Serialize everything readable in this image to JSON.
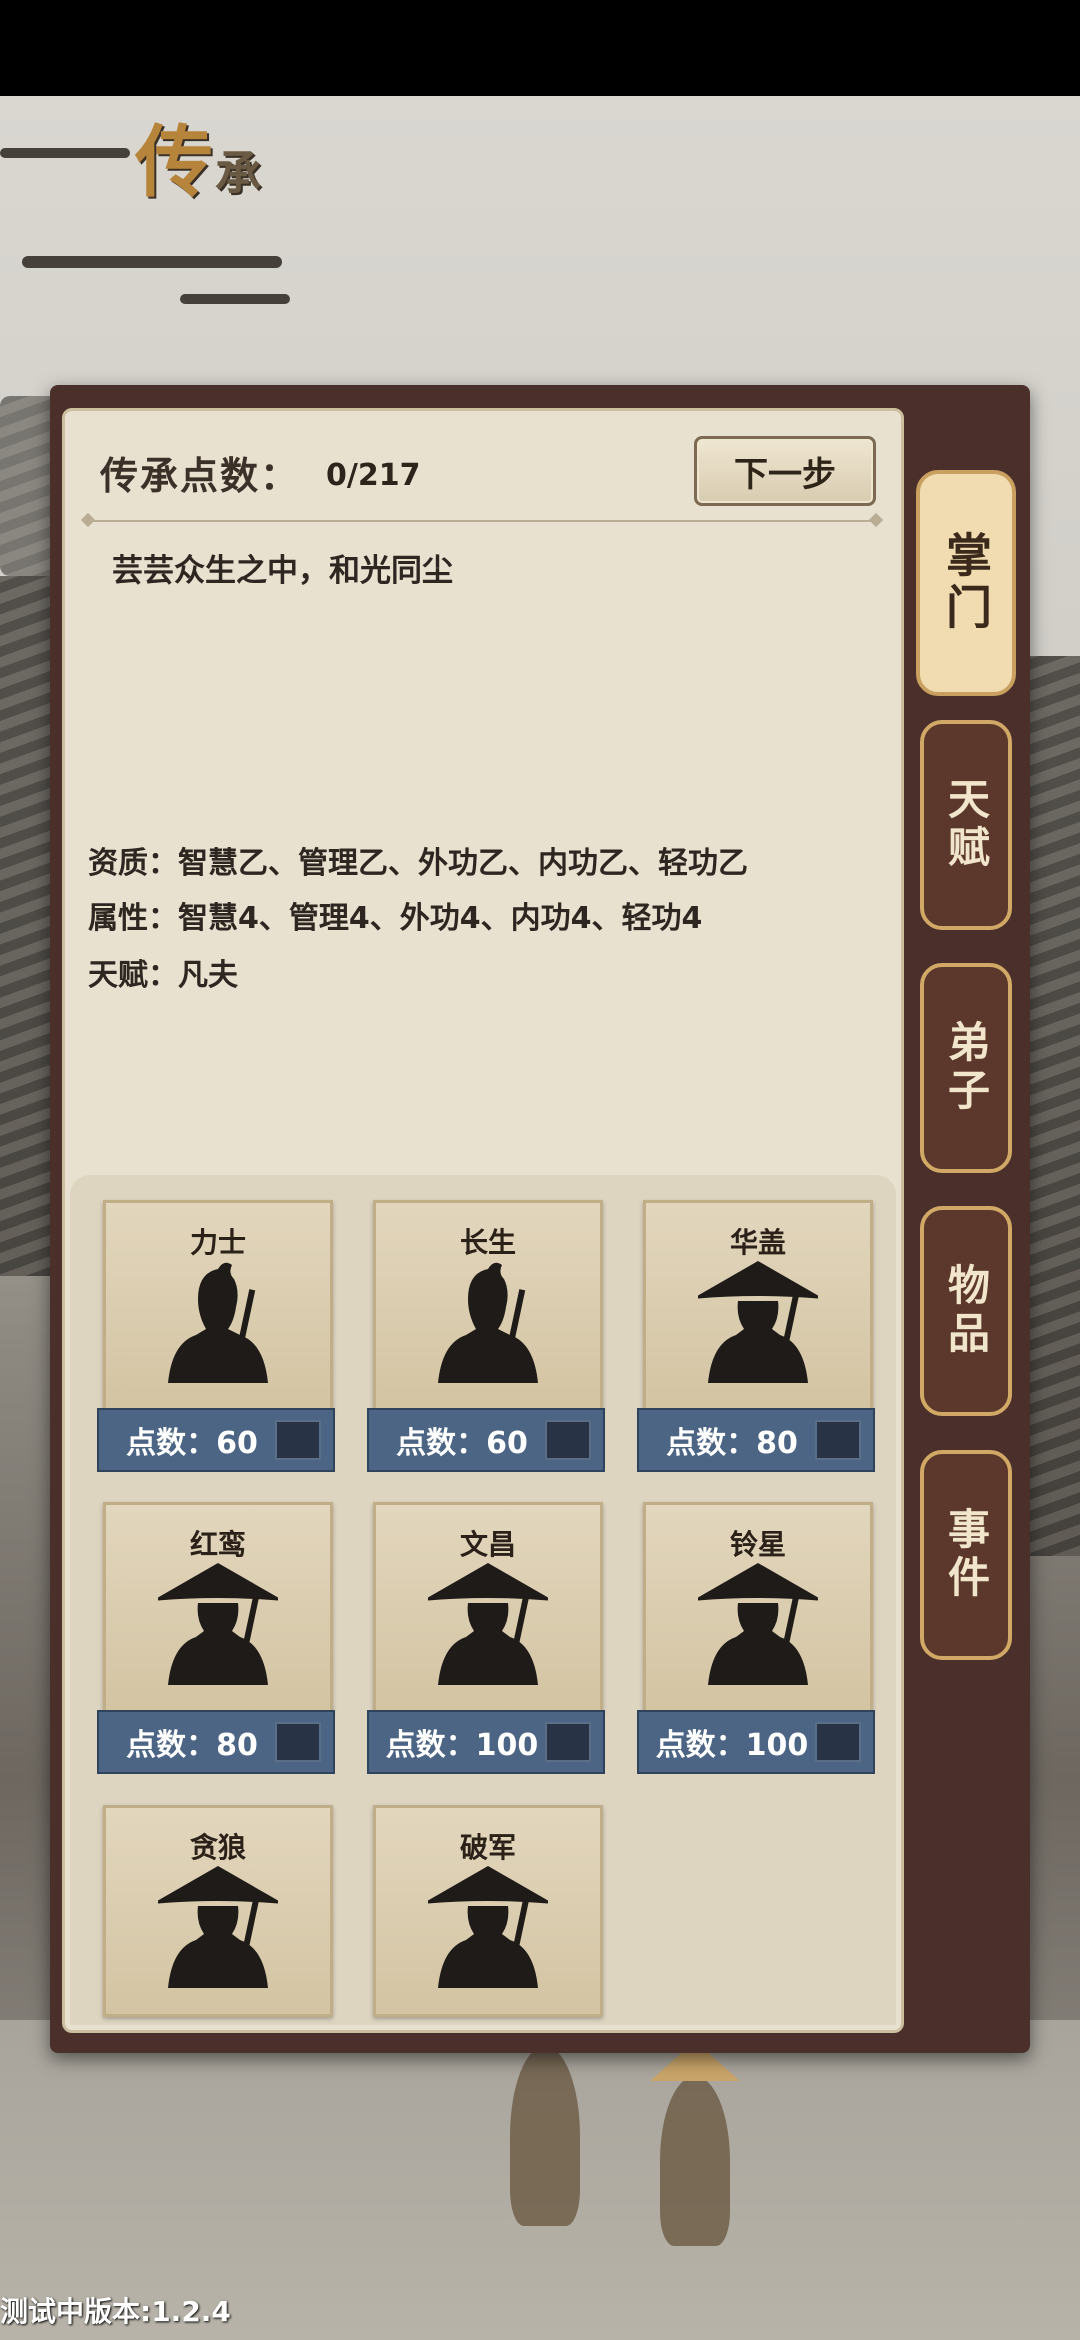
{
  "title": {
    "main": "传",
    "sub": "承"
  },
  "header": {
    "label": "传承点数：",
    "value": "0/217",
    "next_button": "下一步"
  },
  "motto": "芸芸众生之中，和光同尘",
  "stats": {
    "qualification": "资质：智慧乙、管理乙、外功乙、内功乙、轻功乙",
    "attributes": "属性：智慧4、管理4、外功4、内功4、轻功4",
    "talent": "天赋：凡夫"
  },
  "cards": [
    {
      "name": "力士",
      "points": "点数：60",
      "avatar": "topknot-silhouette-icon"
    },
    {
      "name": "长生",
      "points": "点数：60",
      "avatar": "topknot-silhouette-icon"
    },
    {
      "name": "华盖",
      "points": "点数：80",
      "avatar": "straw-hat-silhouette-icon"
    },
    {
      "name": "红鸾",
      "points": "点数：80",
      "avatar": "straw-hat-silhouette-icon"
    },
    {
      "name": "文昌",
      "points": "点数：100",
      "avatar": "straw-hat-silhouette-icon"
    },
    {
      "name": "铃星",
      "points": "点数：100",
      "avatar": "straw-hat-silhouette-icon"
    },
    {
      "name": "贪狼",
      "points": "",
      "avatar": "straw-hat-silhouette-icon"
    },
    {
      "name": "破军",
      "points": "",
      "avatar": "straw-hat-silhouette-icon"
    }
  ],
  "tabs": [
    "掌门",
    "天赋",
    "弟子",
    "物品",
    "事件"
  ],
  "active_tab": 0,
  "version": "测试中版本:1.2.4",
  "colors": {
    "panel": "#4a2f2a",
    "paper": "#e8e1d0",
    "card_footer": "#4c6584",
    "tab_border": "#d1a865"
  }
}
